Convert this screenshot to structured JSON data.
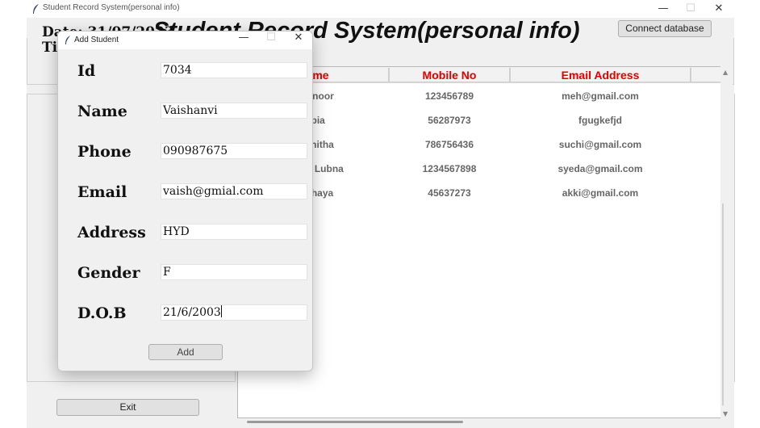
{
  "main_window": {
    "title": "Student Record System(personal info)",
    "controls": {
      "minimize": "—",
      "maximize": "☐",
      "close": "✕"
    },
    "date_label": "Date: 31/07/2023",
    "time_label": "Time:",
    "heading": "Student Record System(personal info)",
    "connect_button": "Connect database",
    "exit_button": "Exit"
  },
  "table": {
    "columns": [
      "Name",
      "Mobile No",
      "Email Address",
      ""
    ],
    "rows": [
      {
        "name": "Mahnoor",
        "mobile": "123456789",
        "email": "meh@gmail.com"
      },
      {
        "name": "rabia",
        "mobile": "56287973",
        "email": "fgugkefjd"
      },
      {
        "name": "Suchitha",
        "mobile": "786756436",
        "email": "suchi@gmail.com"
      },
      {
        "name": "Syeda Lubna",
        "mobile": "1234567898",
        "email": "syeda@gmail.com"
      },
      {
        "name": "Akshaya",
        "mobile": "45637273",
        "email": "akki@gmail.com"
      }
    ]
  },
  "dialog": {
    "title": "Add Student",
    "controls": {
      "minimize": "—",
      "maximize": "☐",
      "close": "✕"
    },
    "fields": [
      {
        "label": "Id",
        "value": "7034"
      },
      {
        "label": "Name",
        "value": "Vaishanvi"
      },
      {
        "label": "Phone",
        "value": "090987675"
      },
      {
        "label": "Email",
        "value": "vaish@gmial.com"
      },
      {
        "label": "Address",
        "value": "HYD"
      },
      {
        "label": "Gender",
        "value": "F"
      },
      {
        "label": "D.O.B",
        "value": "21/6/2003"
      }
    ],
    "add_button": "Add"
  },
  "icons": {
    "app_icon": "feather-icon",
    "scroll_up": "triangle-up-icon",
    "scroll_down": "triangle-down-icon"
  },
  "colors": {
    "header_text": "#e00000",
    "window_bg": "#f0f0f0"
  }
}
